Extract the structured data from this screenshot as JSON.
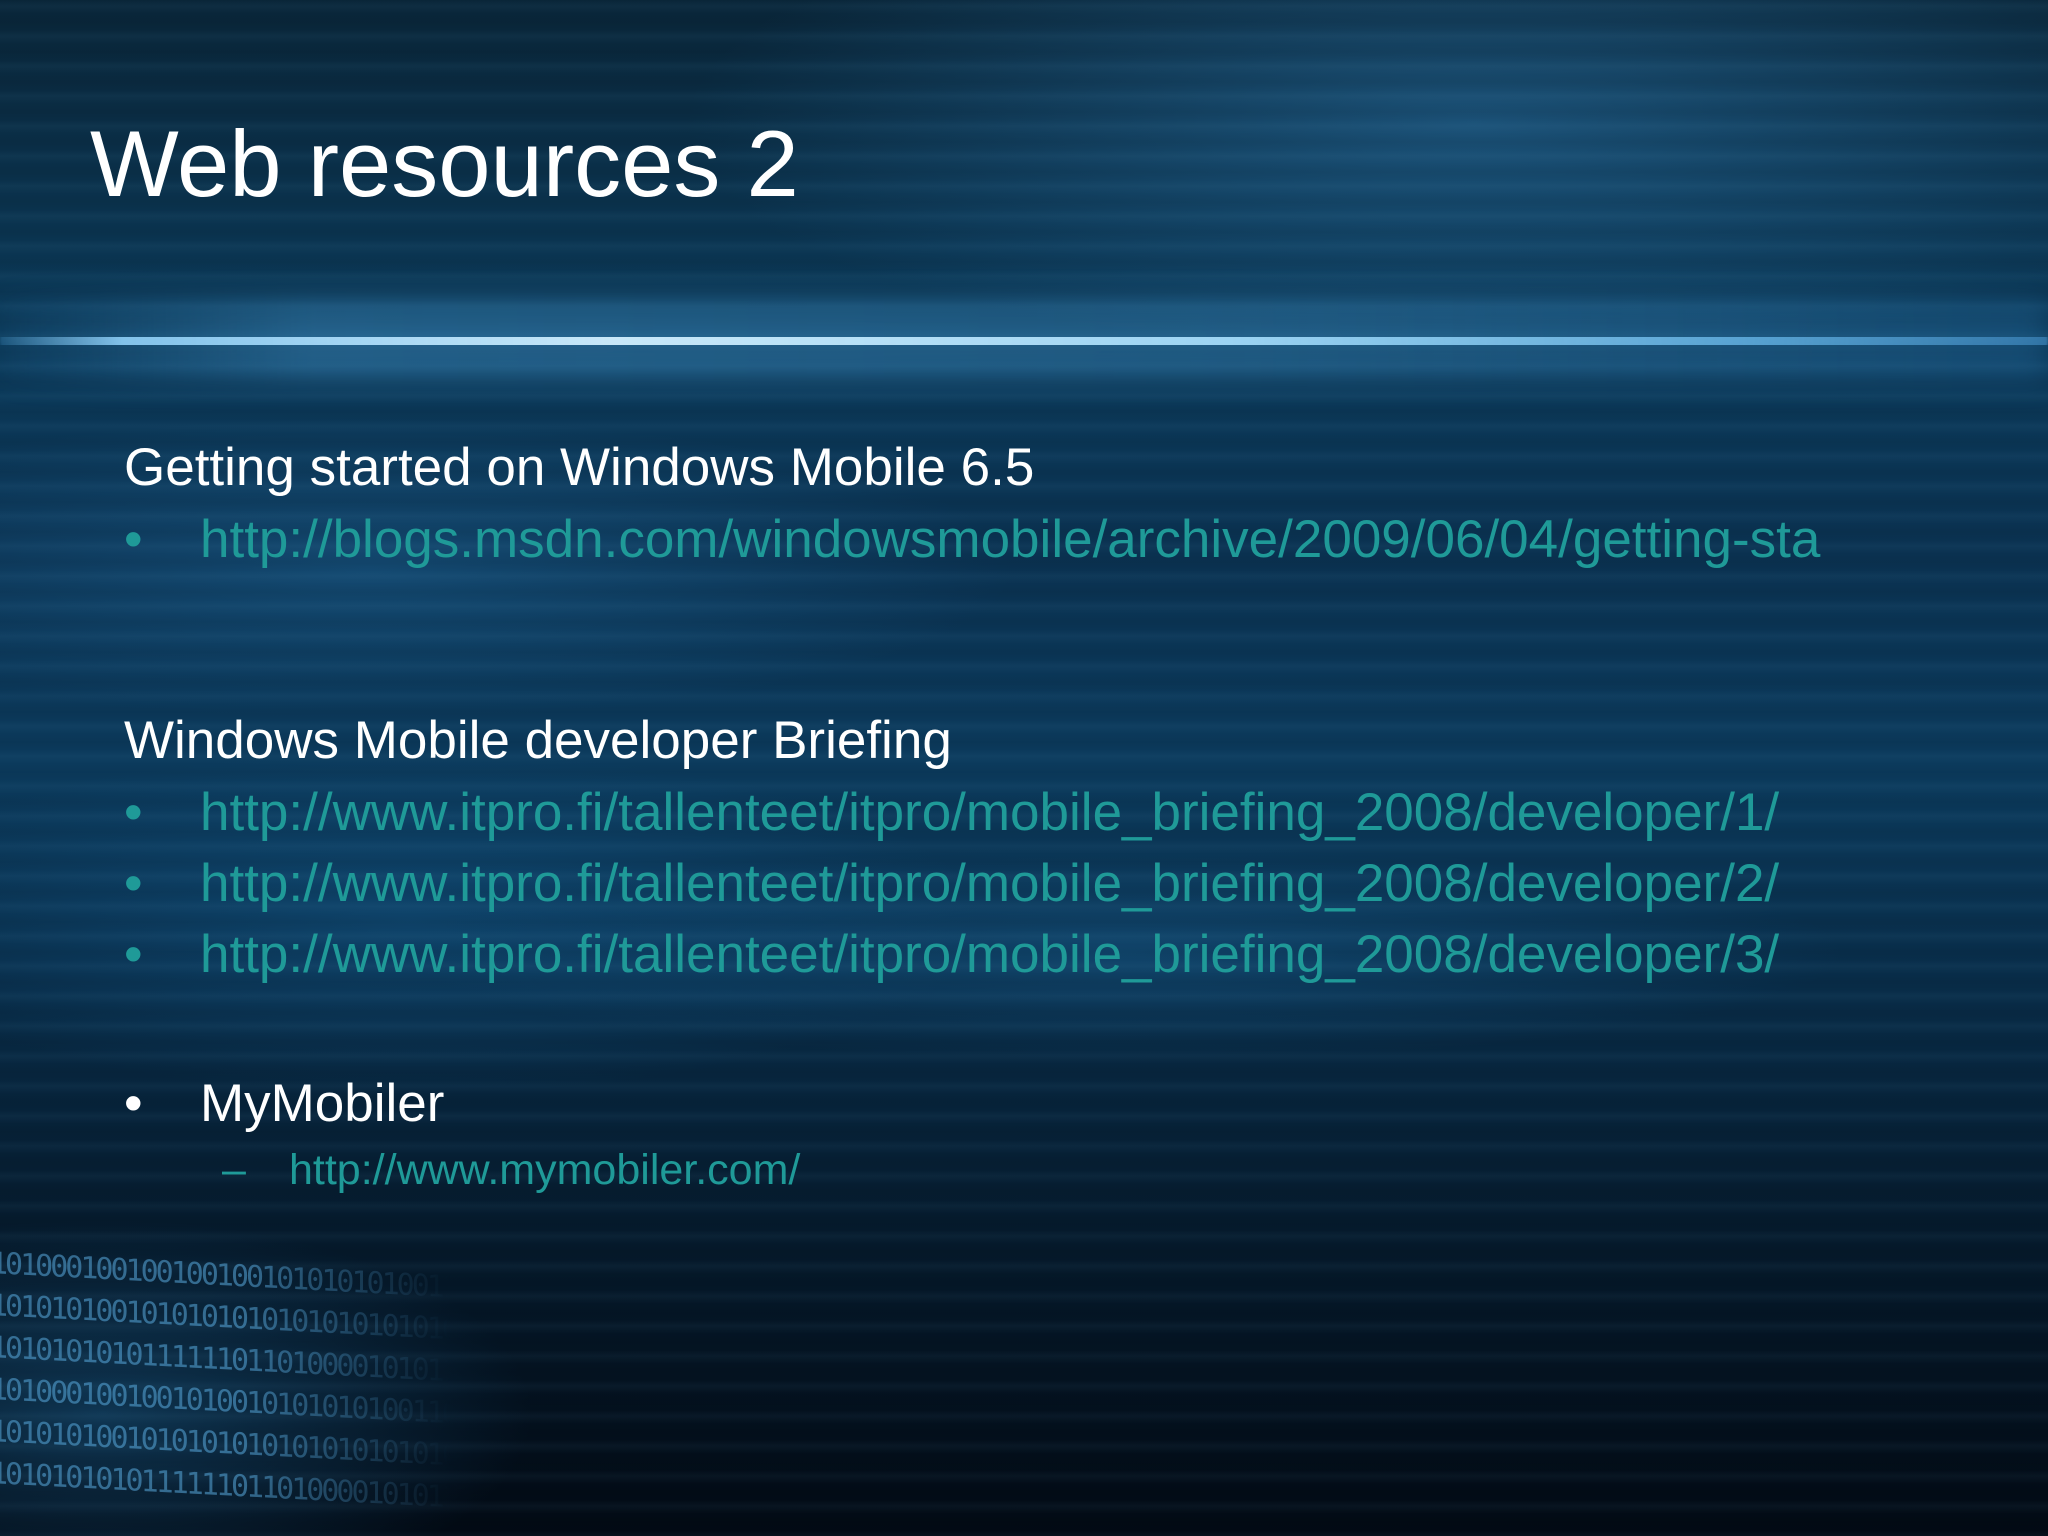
{
  "slide": {
    "title": "Web resources 2",
    "sections": [
      {
        "heading": "Getting started on Windows Mobile 6.5",
        "links": [
          "http://blogs.msdn.com/windowsmobile/archive/2009/06/04/getting-sta"
        ]
      },
      {
        "heading": "Windows Mobile developer Briefing",
        "links": [
          "http://www.itpro.fi/tallenteet/itpro/mobile_briefing_2008/developer/1/",
          "http://www.itpro.fi/tallenteet/itpro/mobile_briefing_2008/developer/2/",
          "http://www.itpro.fi/tallenteet/itpro/mobile_briefing_2008/developer/3/"
        ]
      }
    ],
    "mymobiler": {
      "label": "MyMobiler",
      "link": "http://www.mymobiler.com/"
    },
    "bullet_char": "•",
    "dash_char": "–"
  },
  "colors": {
    "link": "#1f9a98",
    "text": "#ffffff",
    "background": "#0b3a5a"
  }
}
